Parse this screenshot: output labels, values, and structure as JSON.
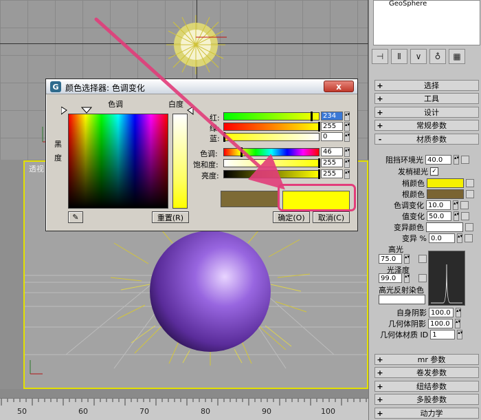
{
  "viewport": {
    "persp_label": "透视"
  },
  "timeline": {
    "ticks": [
      "50",
      "60",
      "70",
      "80",
      "90",
      "100"
    ]
  },
  "panel": {
    "object_name": "GeoSphere",
    "rollouts_top": [
      {
        "sign": "+",
        "title": "选择"
      },
      {
        "sign": "+",
        "title": "工具"
      },
      {
        "sign": "+",
        "title": "设计"
      },
      {
        "sign": "+",
        "title": "常规参数"
      },
      {
        "sign": "-",
        "title": "材质参数"
      }
    ],
    "params": {
      "occlusion_label": "阻挡环境光",
      "occlusion_value": "40.0",
      "emissive_label": "发梢褪光",
      "tip_color_label": "梢颜色",
      "tip_color": "#f5f000",
      "root_color_label": "根颜色",
      "root_color": "#7a6432",
      "hue_var_label": "色调变化",
      "hue_var_value": "10.0",
      "val_var_label": "值变化",
      "val_var_value": "50.0",
      "mutant_color_label": "变异颜色",
      "mutant_color": "#ffffff",
      "mutant_pct_label": "变异 %",
      "mutant_pct_value": "0.0",
      "specular_label": "高光",
      "specular_value": "75.0",
      "gloss_label": "光泽度",
      "gloss_value": "99.0",
      "spec_tint_label": "高光反射染色",
      "self_shadow_label": "自身阴影",
      "self_shadow_value": "100.0",
      "geom_shadow_label": "几何体阴影",
      "geom_shadow_value": "100.0",
      "geom_mtl_label": "几何体材质 ID",
      "geom_mtl_value": "1"
    },
    "rollouts_bottom": [
      {
        "sign": "+",
        "title": "mr 参数"
      },
      {
        "sign": "+",
        "title": "卷发参数"
      },
      {
        "sign": "+",
        "title": "纽结参数"
      },
      {
        "sign": "+",
        "title": "多股参数"
      },
      {
        "sign": "+",
        "title": "动力学"
      }
    ]
  },
  "dialog": {
    "title": "颜色选择器: 色调变化",
    "hue_label": "色调",
    "whiteness_label": "白度",
    "blackness_label_1": "黑",
    "blackness_label_2": "度",
    "reset_label": "重置(R)",
    "ok_label": "确定(O)",
    "cancel_label": "取消(C)",
    "close_label": "x",
    "sliders": [
      {
        "label": "红:",
        "value": "234"
      },
      {
        "label": "绿:",
        "value": "255"
      },
      {
        "label": "蓝:",
        "value": "0"
      },
      {
        "label": "色调:",
        "value": "46"
      },
      {
        "label": "饱和度:",
        "value": "255"
      },
      {
        "label": "亮度:",
        "value": "255"
      }
    ],
    "old_color": "#7d6a35",
    "new_color": "#ffff00"
  }
}
